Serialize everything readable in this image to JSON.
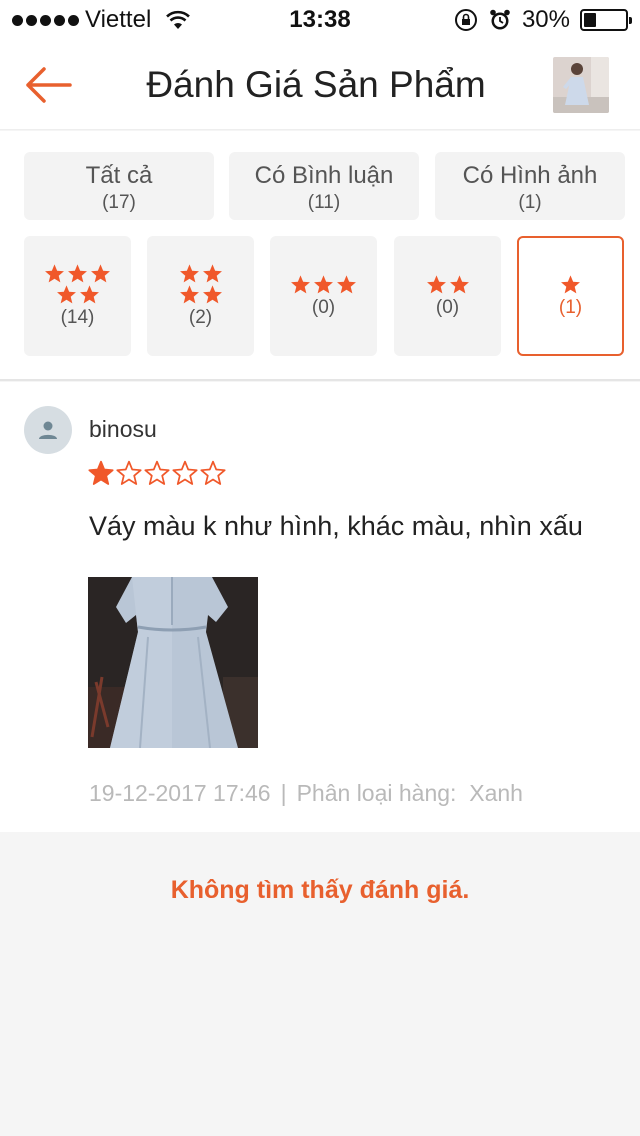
{
  "status_bar": {
    "carrier": "Viettel",
    "time": "13:38",
    "battery_percent": "30%",
    "battery_level": 0.3
  },
  "nav": {
    "title": "Đánh Giá Sản Phẩm",
    "back_icon": "arrow-left-icon",
    "accent": "#e8602e"
  },
  "filters": {
    "all": {
      "label": "Tất cả",
      "count": "(17)"
    },
    "with_comment": {
      "label": "Có Bình luận",
      "count": "(11)"
    },
    "with_image": {
      "label": "Có Hình ảnh",
      "count": "(1)"
    },
    "stars": [
      {
        "stars": 5,
        "count": "(14)"
      },
      {
        "stars": 4,
        "count": "(2)"
      },
      {
        "stars": 3,
        "count": "(0)"
      },
      {
        "stars": 2,
        "count": "(0)"
      },
      {
        "stars": 1,
        "count": "(1)",
        "selected": true
      }
    ]
  },
  "review": {
    "username": "binosu",
    "rating": 1,
    "rating_max": 5,
    "comment": "Váy màu k như hình, khác màu, nhìn xấu",
    "date": "19-12-2017 17:46",
    "separator": "|",
    "variant_label": "Phân loại hàng:",
    "variant_value": "Xanh"
  },
  "empty_message": "Không tìm thấy đánh giá."
}
